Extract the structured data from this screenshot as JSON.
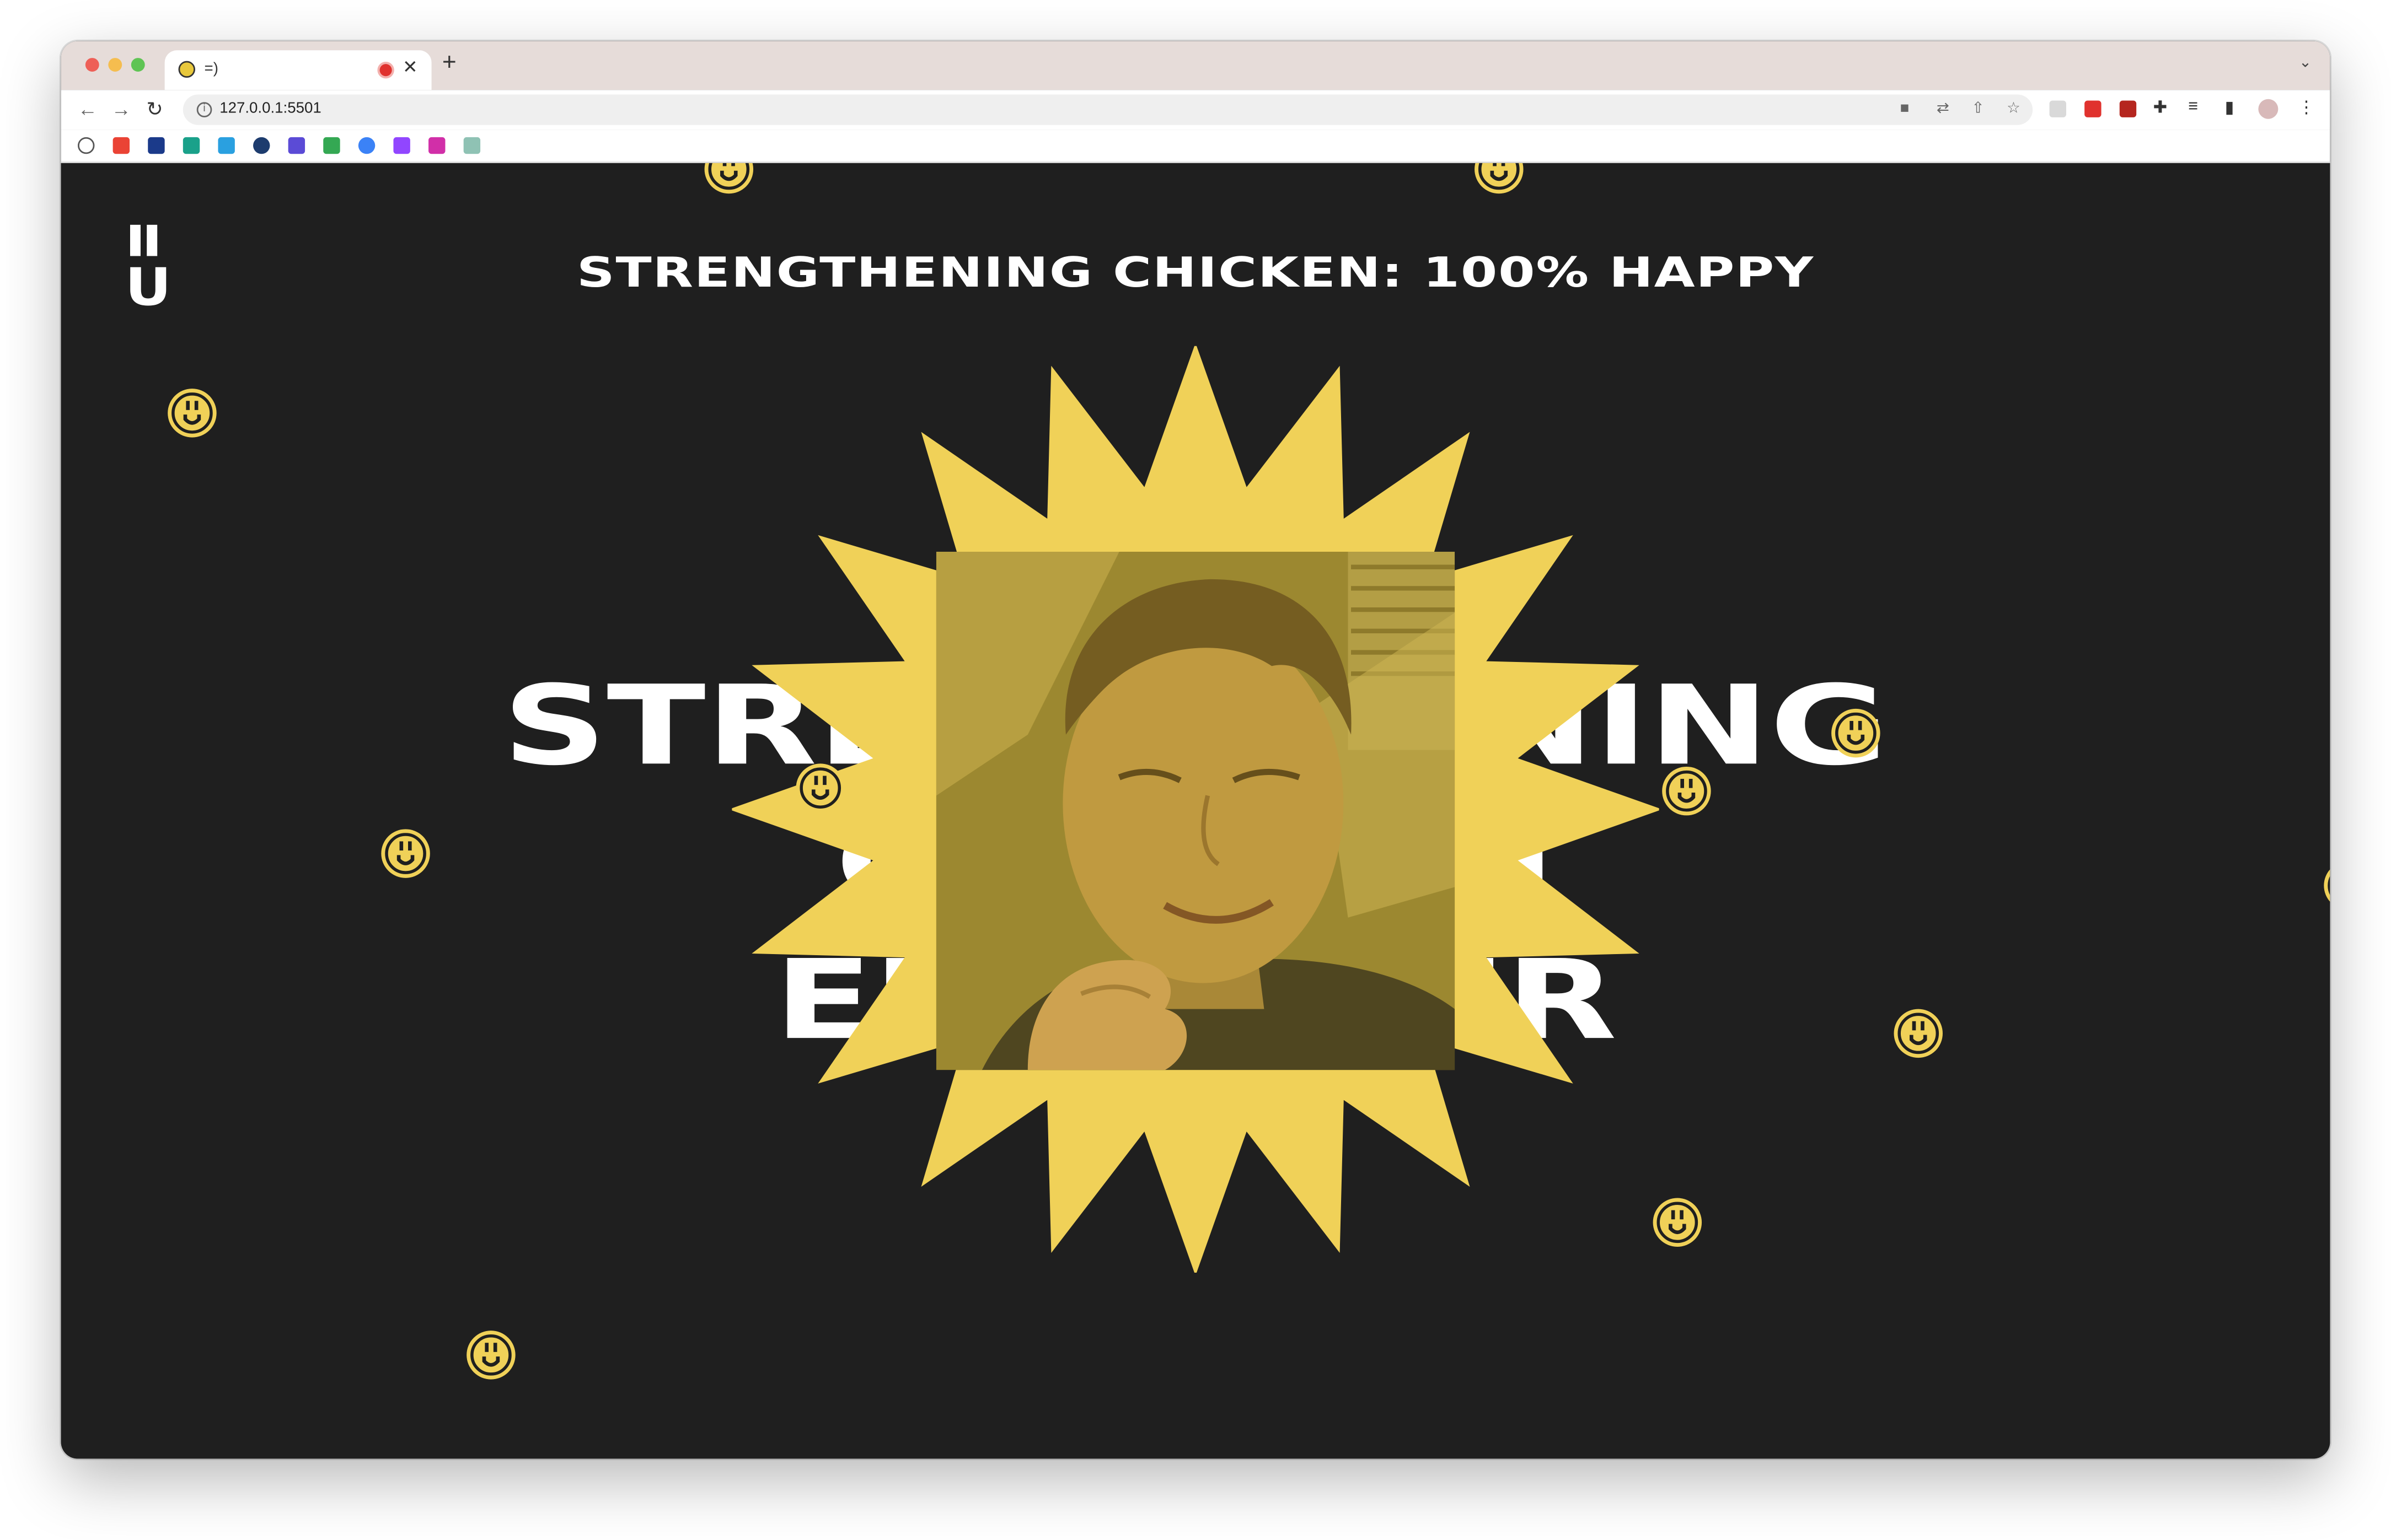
{
  "browser": {
    "tab": {
      "title": "=)"
    },
    "address": {
      "url": "127.0.0.1:5501"
    },
    "new_tab_glyph": "+",
    "close_glyph": "✕"
  },
  "page": {
    "title_bar_text": "STRENGTHENING CHICKEN: 100% HAPPY",
    "logo_top": "II",
    "logo_bottom": "U",
    "big_lines": [
      "STRENGTHENING",
      "CHICKEN",
      "EMPOWER"
    ],
    "photo_subject": "smiling-man-photo"
  },
  "colors": {
    "page_background": "#1f1f1f",
    "accent_yellow": "#f0d158",
    "text": "#ffffff",
    "tab_strip": "#e6dcd9"
  },
  "icons": {
    "smiley": "smiley-icon",
    "starburst": "starburst-shape"
  }
}
